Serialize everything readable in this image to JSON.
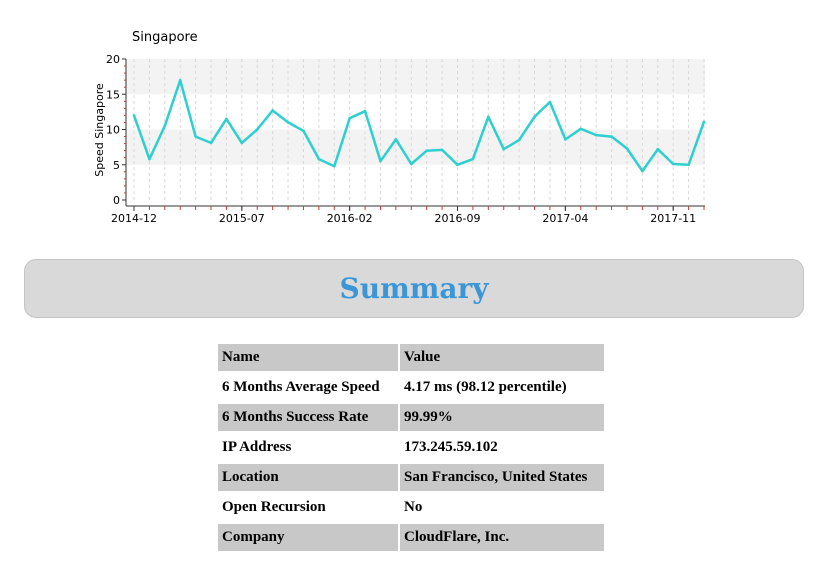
{
  "chart_data": {
    "type": "line",
    "title": "Singapore",
    "ylabel": "Speed Singapore",
    "xlabel": "",
    "ylim": [
      0,
      20
    ],
    "yticks": [
      0,
      5,
      10,
      15,
      20
    ],
    "xtick_labels": [
      "2014-12",
      "2015-07",
      "2016-02",
      "2016-09",
      "2017-04",
      "2017-11"
    ],
    "grid": true,
    "series_color": "#2ecfcf",
    "series": [
      {
        "name": "",
        "values": [
          12.0,
          5.8,
          10.5,
          17.0,
          9.0,
          8.1,
          11.5,
          8.1,
          10.0,
          12.7,
          11.0,
          9.8,
          5.8,
          4.8,
          11.6,
          12.6,
          5.5,
          8.6,
          5.1,
          7.0,
          7.1,
          5.0,
          5.8,
          11.8,
          7.2,
          8.5,
          11.8,
          13.9,
          8.6,
          10.1,
          9.2,
          9.0,
          7.3,
          4.1,
          7.2,
          5.1,
          5.0,
          11.1
        ]
      }
    ]
  },
  "summary": {
    "heading": "Summary",
    "rows": [
      {
        "label": "Name",
        "value": "Value"
      },
      {
        "label": "6 Months Average Speed",
        "value": "4.17 ms (98.12 percentile)"
      },
      {
        "label": "6 Months Success Rate",
        "value": "99.99%"
      },
      {
        "label": "IP Address",
        "value": "173.245.59.102"
      },
      {
        "label": "Location",
        "value": "San Francisco, United States"
      },
      {
        "label": "Open Recursion",
        "value": "No"
      },
      {
        "label": "Company",
        "value": "CloudFlare, Inc."
      }
    ]
  }
}
